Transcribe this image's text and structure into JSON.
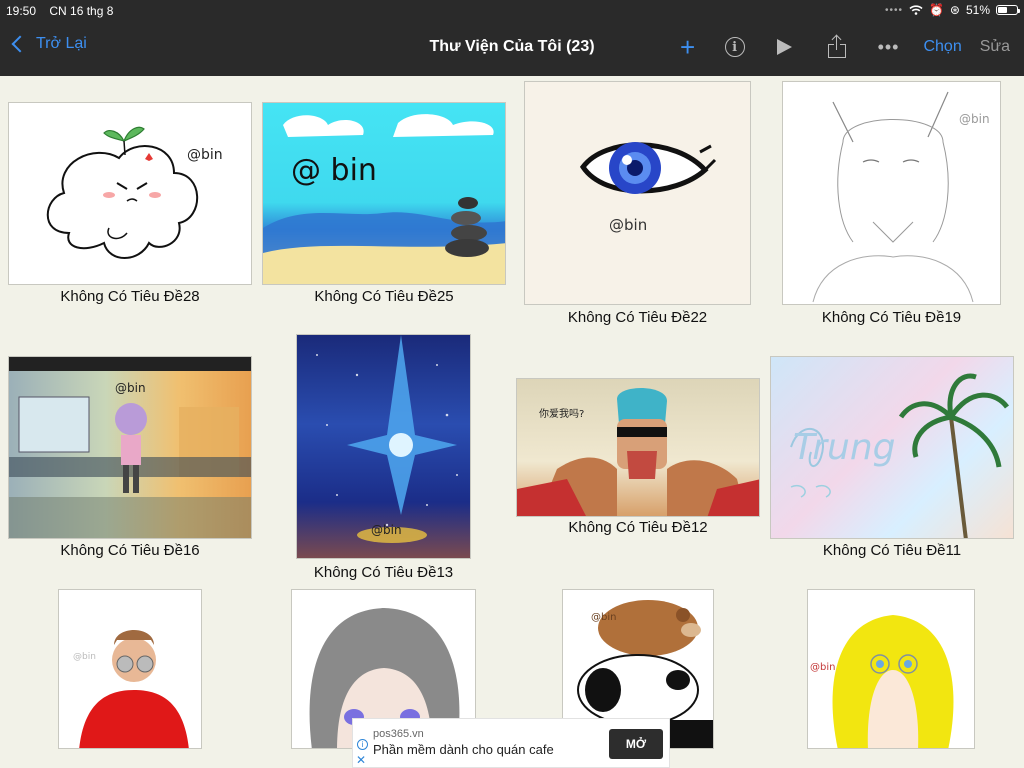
{
  "status_bar": {
    "time": "19:50",
    "date": "CN 16 thg 8",
    "battery_percent": "51%",
    "battery_level": 0.51
  },
  "nav": {
    "back_label": "Trở Lại",
    "title": "Thư Viện Của Tôi (23)",
    "plus_glyph": "+",
    "info_glyph": "i",
    "more_glyph": "•••",
    "select_label": "Chọn",
    "edit_label": "Sửa",
    "accent_color": "#3d8ff0"
  },
  "gallery": {
    "items": [
      {
        "title": "Không Có Tiêu Đề28",
        "art_text": "@bin"
      },
      {
        "title": "Không Có Tiêu Đề25",
        "art_text": "@ bin"
      },
      {
        "title": "Không Có Tiêu Đề22",
        "art_text": "@bin"
      },
      {
        "title": "Không Có Tiêu Đề19",
        "art_text": "@bin"
      },
      {
        "title": "Không Có Tiêu Đề16",
        "art_text": "@bin"
      },
      {
        "title": "Không Có Tiêu Đề13",
        "art_text": "@bin"
      },
      {
        "title": "Không Có Tiêu Đề12",
        "art_text": "你爱我吗?"
      },
      {
        "title": "Không Có Tiêu Đề11",
        "art_text": "Trung"
      },
      {
        "title": "",
        "art_text": "@bin"
      },
      {
        "title": "",
        "art_text": ""
      },
      {
        "title": "",
        "art_text": "@bin"
      },
      {
        "title": "",
        "art_text": "@bin"
      }
    ]
  },
  "ad": {
    "source": "pos365.vn",
    "text": "Phần mềm dành cho quán cafe",
    "button_label": "MỞ",
    "close_glyph": "✕",
    "info_glyph": "i"
  }
}
